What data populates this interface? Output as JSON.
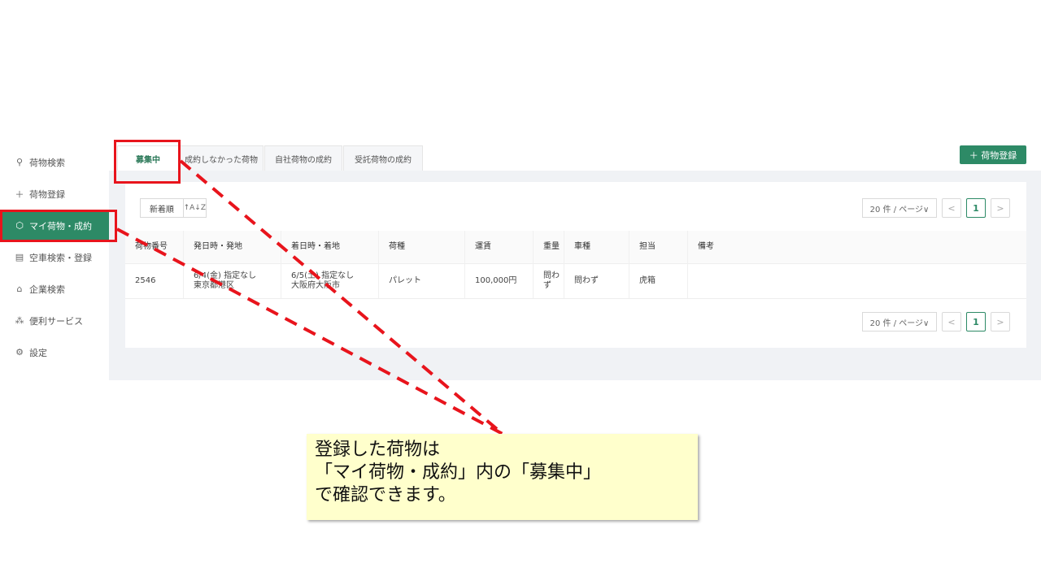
{
  "sidebar": {
    "items": [
      {
        "label": "荷物検索",
        "icon": "search-icon"
      },
      {
        "label": "荷物登録",
        "icon": "plus-icon"
      },
      {
        "label": "マイ荷物・成約",
        "icon": "box-icon"
      },
      {
        "label": "空車検索・登録",
        "icon": "truck-icon"
      },
      {
        "label": "企業検索",
        "icon": "home-icon"
      },
      {
        "label": "便利サービス",
        "icon": "network-icon"
      },
      {
        "label": "設定",
        "icon": "gear-icon"
      }
    ],
    "active_index": 2
  },
  "tabs": [
    "募集中",
    "成約しなかった荷物",
    "自社荷物の成約",
    "受託荷物の成約"
  ],
  "add_button": "＋ 荷物登録",
  "sort": {
    "label": "新着順",
    "order_icon": "↑A↓Z"
  },
  "pagination": {
    "per_page": "20 件 / ページ∨",
    "prev": "<",
    "current": "1",
    "next": ">"
  },
  "table": {
    "headers": [
      "荷物番号",
      "発日時・発地",
      "着日時・着地",
      "荷種",
      "運賃",
      "重量",
      "車種",
      "担当",
      "備考"
    ],
    "rows": [
      {
        "number": "2546",
        "depart_line1": "6/4(金) 指定なし",
        "depart_line2": "東京都港区",
        "arrive_line1": "6/5(土) 指定なし",
        "arrive_line2": "大阪府大阪市",
        "cargo": "パレット",
        "fare": "100,000円",
        "weight_line1": "問わ",
        "weight_line2": "ず",
        "vehicle": "問わず",
        "staff": "虎箱",
        "note": ""
      }
    ]
  },
  "callout": {
    "line1": "登録した荷物は",
    "line2": "「マイ荷物・成約」内の「募集中」",
    "line3": "で確認できます。"
  },
  "colors": {
    "accent": "#2d8a66",
    "highlight": "#e8141c",
    "callout_bg": "#ffffcc"
  }
}
